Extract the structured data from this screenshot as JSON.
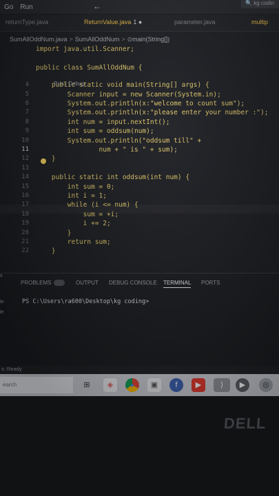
{
  "menubar": {
    "items": [
      "Go",
      "Run"
    ],
    "back_glyph": "←",
    "search_text": "kg codin"
  },
  "tabs": [
    {
      "label": "returnType.java",
      "active": false
    },
    {
      "label": "ReturnValue.java",
      "active": true,
      "modified": "1 ●"
    },
    {
      "label": "parameter.java",
      "active": false
    },
    {
      "label": "multip",
      "active": false
    }
  ],
  "breadcrumb": {
    "file": "SumAllOddNum.java",
    "cls": "SumAllOddNum",
    "method": "main(String[])",
    "sep": ">"
  },
  "codelens": "Run | Debug",
  "code_lines": [
    {
      "n": "",
      "text": "import java.util.Scanner;"
    },
    {
      "n": "",
      "text": ""
    },
    {
      "n": "",
      "text": "public class SumAllOddNum {"
    },
    {
      "n": "4",
      "text": "    public static void main(String[] args) {"
    },
    {
      "n": "5",
      "text": "        Scanner input = new Scanner(System.in);"
    },
    {
      "n": "6",
      "text": "        System.out.println(x:\"welcome to count sum\");"
    },
    {
      "n": "7",
      "text": "        System.out.println(x:\"please enter your number :\");"
    },
    {
      "n": "8",
      "text": "        int num = input.nextInt();"
    },
    {
      "n": "9",
      "text": "        int sum = oddsum(num);"
    },
    {
      "n": "10",
      "text": "        System.out.println(\"oddsum till\" +"
    },
    {
      "n": "11",
      "text": "                num + \" is \" + sum);"
    },
    {
      "n": "12",
      "text": "    }"
    },
    {
      "n": "13",
      "text": ""
    },
    {
      "n": "14",
      "text": "    public static int oddsum(int num) {"
    },
    {
      "n": "15",
      "text": "        int sum = 0;"
    },
    {
      "n": "16",
      "text": "        int i = 1;"
    },
    {
      "n": "17",
      "text": "        while (i <= num) {"
    },
    {
      "n": "18",
      "text": "            sum = +i;"
    },
    {
      "n": "19",
      "text": "            i += 2;"
    },
    {
      "n": "20",
      "text": "        }"
    },
    {
      "n": "21",
      "text": "        return sum;"
    },
    {
      "n": "22",
      "text": "    }"
    }
  ],
  "panel": {
    "tabs": [
      "PROBLEMS",
      "OUTPUT",
      "DEBUG CONSOLE",
      "TERMINAL",
      "PORTS"
    ],
    "active_tab": "TERMINAL",
    "prompt": "PS C:\\Users\\ra600\\Desktop\\kg coding>",
    "left_fragments": [
      "s",
      "le",
      "le"
    ]
  },
  "statusbar": {
    "text": "s: Ready"
  },
  "taskbar": {
    "search_text": "earch",
    "icons": [
      "task-view-icon",
      "chrome-icon",
      "file-icon",
      "facebook-icon",
      "youtube-icon",
      "vscode-icon",
      "media-icon",
      "network-icon"
    ]
  },
  "bezel": {
    "logo": "DELL"
  },
  "colors": {
    "keyword": "#e2c86a",
    "background": "#1b1d22",
    "accent": "#f0c04a"
  }
}
